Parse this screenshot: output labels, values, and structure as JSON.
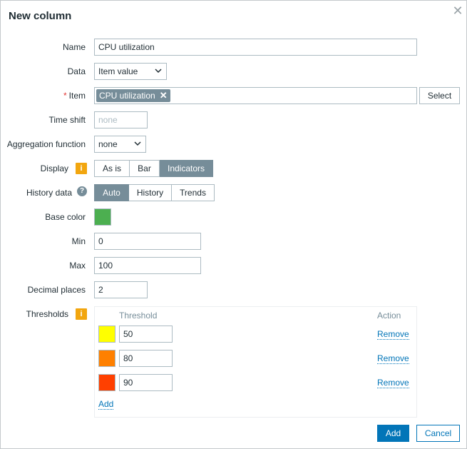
{
  "dialog": {
    "title": "New column"
  },
  "fields": {
    "name": {
      "label": "Name",
      "value": "CPU utilization"
    },
    "data": {
      "label": "Data",
      "value": "Item value"
    },
    "item": {
      "label": "Item",
      "required_mark": "*",
      "tag": "CPU utilization",
      "select_label": "Select"
    },
    "time_shift": {
      "label": "Time shift",
      "placeholder": "none"
    },
    "aggregation": {
      "label": "Aggregation function",
      "value": "none"
    },
    "display": {
      "label": "Display",
      "options": [
        "As is",
        "Bar",
        "Indicators"
      ],
      "selected": "Indicators"
    },
    "history": {
      "label": "History data",
      "options": [
        "Auto",
        "History",
        "Trends"
      ],
      "selected": "Auto"
    },
    "base_color": {
      "label": "Base color",
      "color": "#4caf50"
    },
    "min": {
      "label": "Min",
      "value": "0"
    },
    "max": {
      "label": "Max",
      "value": "100"
    },
    "decimal_places": {
      "label": "Decimal places",
      "value": "2"
    }
  },
  "thresholds": {
    "label": "Thresholds",
    "header_threshold": "Threshold",
    "header_action": "Action",
    "rows": [
      {
        "color": "#ffff00",
        "value": "50",
        "action": "Remove"
      },
      {
        "color": "#ff8000",
        "value": "80",
        "action": "Remove"
      },
      {
        "color": "#ff4000",
        "value": "90",
        "action": "Remove"
      }
    ],
    "add_label": "Add"
  },
  "footer": {
    "add_label": "Add",
    "cancel_label": "Cancel"
  },
  "icons": {
    "info": "info-icon",
    "help": "help-icon",
    "close": "close-icon",
    "remove_tag": "close-icon"
  },
  "colors": {
    "accent": "#0275b8",
    "active_segment": "#768d99",
    "info_icon": "#f2a60f"
  }
}
